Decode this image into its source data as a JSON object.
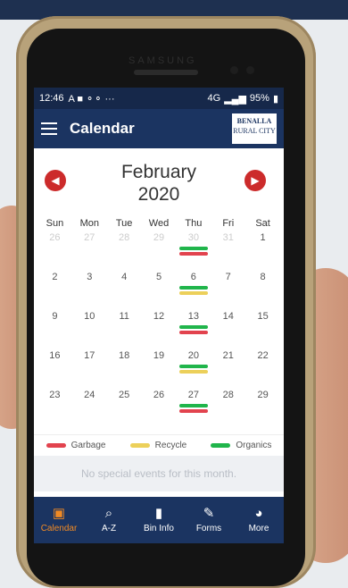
{
  "status_bar": {
    "time": "12:46",
    "left_icons": "A ■ ⚬⚬ ···",
    "signal": "4G",
    "battery": "95%"
  },
  "app_bar": {
    "title": "Calendar",
    "logo_line1": "BENALLA",
    "logo_line2": "RURAL CITY"
  },
  "calendar": {
    "month": "February",
    "year": "2020",
    "prev_glyph": "◀",
    "next_glyph": "▶",
    "weekdays": [
      "Sun",
      "Mon",
      "Tue",
      "Wed",
      "Thu",
      "Fri",
      "Sat"
    ],
    "weeks": [
      [
        {
          "day": "26",
          "other": true
        },
        {
          "day": "27",
          "other": true
        },
        {
          "day": "28",
          "other": true
        },
        {
          "day": "29",
          "other": true
        },
        {
          "day": "30",
          "other": true,
          "bins": [
            "organics",
            "garbage"
          ]
        },
        {
          "day": "31",
          "other": true
        },
        {
          "day": "1"
        }
      ],
      [
        {
          "day": "2"
        },
        {
          "day": "3"
        },
        {
          "day": "4"
        },
        {
          "day": "5"
        },
        {
          "day": "6",
          "bins": [
            "organics",
            "recycle"
          ]
        },
        {
          "day": "7"
        },
        {
          "day": "8"
        }
      ],
      [
        {
          "day": "9"
        },
        {
          "day": "10"
        },
        {
          "day": "11"
        },
        {
          "day": "12"
        },
        {
          "day": "13",
          "bins": [
            "organics",
            "garbage"
          ]
        },
        {
          "day": "14"
        },
        {
          "day": "15"
        }
      ],
      [
        {
          "day": "16"
        },
        {
          "day": "17"
        },
        {
          "day": "18"
        },
        {
          "day": "19"
        },
        {
          "day": "20",
          "bins": [
            "organics",
            "recycle"
          ]
        },
        {
          "day": "21"
        },
        {
          "day": "22"
        }
      ],
      [
        {
          "day": "23"
        },
        {
          "day": "24"
        },
        {
          "day": "25"
        },
        {
          "day": "26"
        },
        {
          "day": "27",
          "bins": [
            "organics",
            "garbage"
          ]
        },
        {
          "day": "28"
        },
        {
          "day": "29"
        }
      ]
    ]
  },
  "legend": {
    "garbage": {
      "label": "Garbage",
      "color": "#e2434e"
    },
    "recycle": {
      "label": "Recycle",
      "color": "#ecd05a"
    },
    "organics": {
      "label": "Organics",
      "color": "#20b54b"
    }
  },
  "no_events_text": "No special events for this month.",
  "bottom_nav": [
    {
      "label": "Calendar",
      "icon": "calendar-icon",
      "glyph": "▣",
      "active": true
    },
    {
      "label": "A-Z",
      "icon": "search-icon",
      "glyph": "⌕",
      "active": false
    },
    {
      "label": "Bin Info",
      "icon": "bin-icon",
      "glyph": "▮",
      "active": false
    },
    {
      "label": "Forms",
      "icon": "pencil-icon",
      "glyph": "✎",
      "active": false
    },
    {
      "label": "More",
      "icon": "pie-chart-icon",
      "glyph": "◕",
      "active": false
    }
  ],
  "device": {
    "brand": "SAMSUNG"
  }
}
